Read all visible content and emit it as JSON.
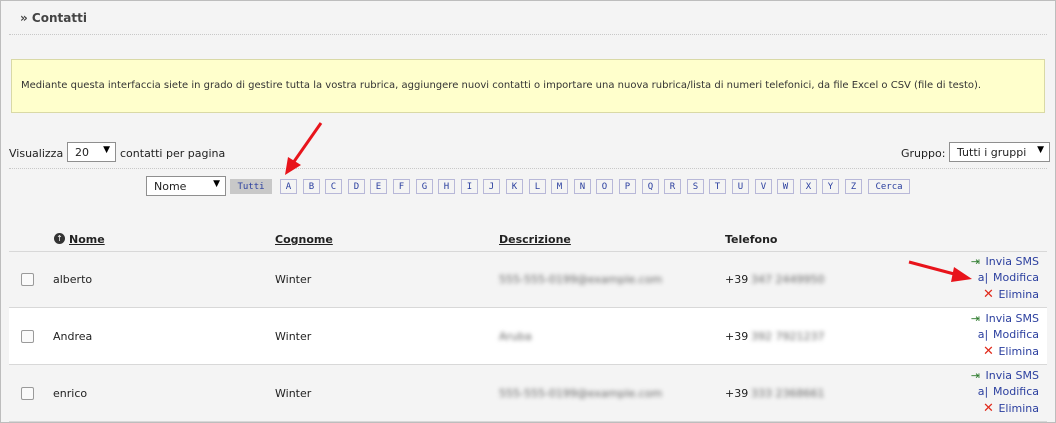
{
  "page": {
    "title": "» Contatti",
    "info_text": "Mediante questa interfaccia siete in grado di gestire tutta la vostra rubrica, aggiungere nuovi contatti o importare una nuova rubrica/lista di numeri telefonici, da file Excel o CSV (file di testo)."
  },
  "controls": {
    "show_label": "Visualizza",
    "per_page_value": "20",
    "per_page_suffix": "contatti per pagina",
    "group_label": "Gruppo:",
    "group_value": "Tutti i gruppi",
    "sort_field_value": "Nome"
  },
  "letters": {
    "all_label": "Tutti",
    "items": [
      "A",
      "B",
      "C",
      "D",
      "E",
      "F",
      "G",
      "H",
      "I",
      "J",
      "K",
      "L",
      "M",
      "N",
      "O",
      "P",
      "Q",
      "R",
      "S",
      "T",
      "U",
      "V",
      "W",
      "X",
      "Y",
      "Z"
    ],
    "search_label": "Cerca"
  },
  "table": {
    "headers": {
      "name": "Nome",
      "surname": "Cognome",
      "description": "Descrizione",
      "phone": "Telefono"
    },
    "rows": [
      {
        "name": "alberto",
        "surname": "Winter",
        "description": "555-555-0199@example.com",
        "prefix": "+39",
        "phone": "347 2449950"
      },
      {
        "name": "Andrea",
        "surname": "Winter",
        "description": "Aruba",
        "prefix": "+39",
        "phone": "392 7921237"
      },
      {
        "name": "enrico",
        "surname": "Winter",
        "description": "555-555-0199@example.com",
        "prefix": "+39",
        "phone": "333 2368661"
      }
    ],
    "actions": {
      "sms": "Invia SMS",
      "edit": "Modifica",
      "delete": "Elimina"
    }
  },
  "icons": {
    "sms": "sms-send-icon",
    "edit": "edit-icon",
    "delete": "delete-icon",
    "sort": "sort-up-icon",
    "dropdown": "chevron-down-icon"
  },
  "colors": {
    "link": "#2b3f9f",
    "info_bg": "#ffffcc",
    "delete": "#e0291a",
    "arrow": "#e8141b"
  }
}
